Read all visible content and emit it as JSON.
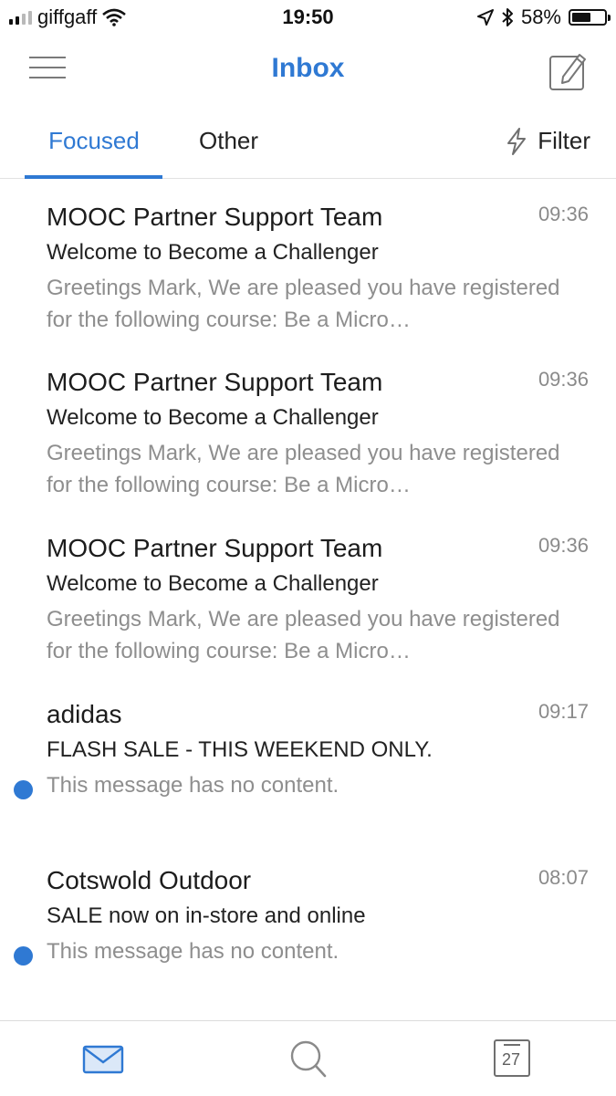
{
  "status_bar": {
    "carrier": "giffgaff",
    "time": "19:50",
    "battery_percent": "58%",
    "battery_level": 0.58
  },
  "header": {
    "title": "Inbox",
    "menu_icon": "hamburger-menu-icon",
    "compose_icon": "compose-icon"
  },
  "tabs": {
    "focused": "Focused",
    "other": "Other",
    "filter": "Filter",
    "active": "focused"
  },
  "messages": [
    {
      "sender": "MOOC Partner Support Team",
      "time": "09:36",
      "subject": "Welcome to Become a Challenger",
      "preview": "Greetings Mark, We are pleased you have registered for the following course: Be a Micro…",
      "unread": false
    },
    {
      "sender": "MOOC Partner Support Team",
      "time": "09:36",
      "subject": "Welcome to Become a Challenger",
      "preview": "Greetings Mark, We are pleased you have registered for the following course: Be a Micro…",
      "unread": false
    },
    {
      "sender": "MOOC Partner Support Team",
      "time": "09:36",
      "subject": "Welcome to Become a Challenger",
      "preview": "Greetings Mark, We are pleased you have registered for the following course: Be a Micro…",
      "unread": false
    },
    {
      "sender": "adidas",
      "time": "09:17",
      "subject": "FLASH SALE - THIS WEEKEND ONLY.",
      "preview": "This message has no content.",
      "unread": true
    },
    {
      "sender": "Cotswold Outdoor",
      "time": "08:07",
      "subject": "SALE now on in-store and online",
      "preview": "This message has no content.",
      "unread": true
    }
  ],
  "bottom_nav": {
    "calendar_day": "27",
    "items": [
      "mail-icon",
      "search-icon",
      "calendar-icon"
    ]
  },
  "colors": {
    "accent": "#2f79d3",
    "muted_text": "#8e8e8e"
  }
}
